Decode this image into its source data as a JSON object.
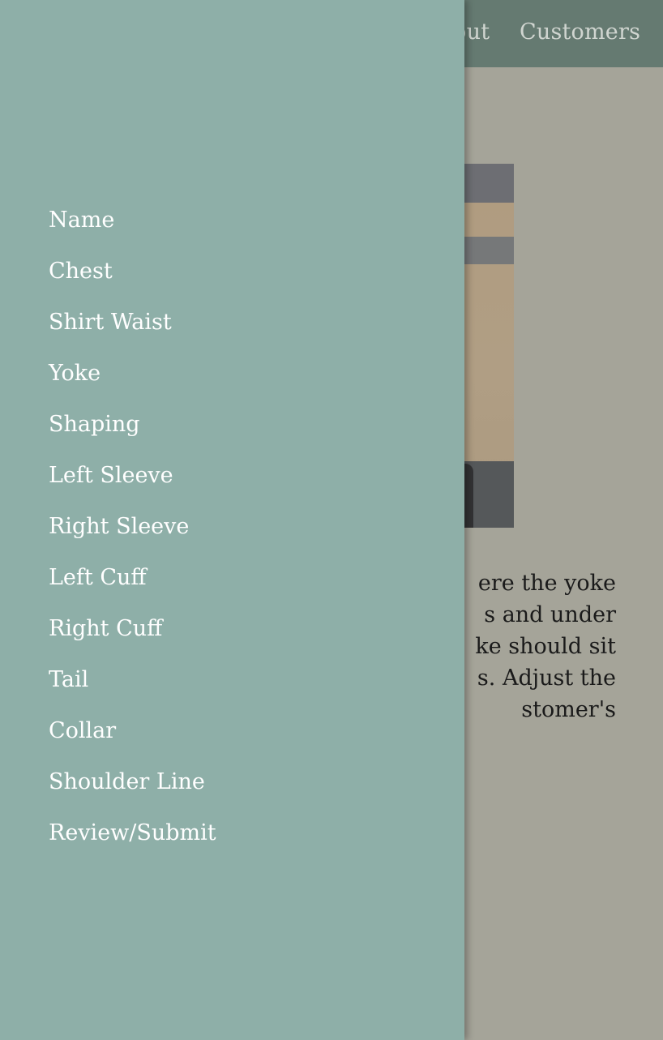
{
  "topbar": {
    "nav": [
      "About",
      "Customers"
    ]
  },
  "content": {
    "text_lines": [
      "ere the yoke",
      "s and under",
      "ke should sit",
      "s. Adjust the",
      "stomer's"
    ]
  },
  "drawer": {
    "items": [
      "Name",
      "Chest",
      "Shirt Waist",
      "Yoke",
      "Shaping",
      "Left Sleeve",
      "Right Sleeve",
      "Left Cuff",
      "Right Cuff",
      "Tail",
      "Collar",
      "Shoulder Line",
      "Review/Submit"
    ]
  },
  "colors": {
    "drawer_bg": "#8eafa8",
    "topbar_bg": "#657a71",
    "page_bg": "#a5a499"
  }
}
